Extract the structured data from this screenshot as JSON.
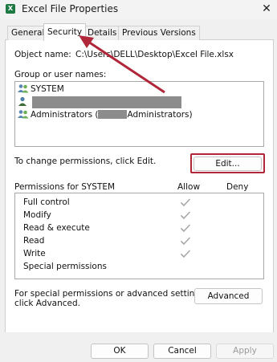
{
  "window": {
    "title": "Excel File Properties",
    "app_icon_letter": "X",
    "close_glyph": "✕"
  },
  "tabs": [
    {
      "label": "General"
    },
    {
      "label": "Security"
    },
    {
      "label": "Details"
    },
    {
      "label": "Previous Versions"
    }
  ],
  "security": {
    "object_name_label": "Object name:",
    "object_name_value": "C:\\Users\\DELL\\Desktop\\Excel File.xlsx",
    "group_label": "Group or user names:",
    "users": [
      {
        "name": "SYSTEM",
        "icon": "user-group-icon"
      },
      {
        "name": "",
        "icon": "user-icon"
      },
      {
        "name": "Administrators (",
        "suffix": "Administrators)",
        "icon": "user-group-icon"
      }
    ],
    "change_text": "To change permissions, click Edit.",
    "edit_button": "Edit...",
    "permissions_for": "Permissions for SYSTEM",
    "allow_header": "Allow",
    "deny_header": "Deny",
    "permissions": [
      {
        "name": "Full control",
        "allow": true,
        "deny": false
      },
      {
        "name": "Modify",
        "allow": true,
        "deny": false
      },
      {
        "name": "Read & execute",
        "allow": true,
        "deny": false
      },
      {
        "name": "Read",
        "allow": true,
        "deny": false
      },
      {
        "name": "Write",
        "allow": true,
        "deny": false
      },
      {
        "name": "Special permissions",
        "allow": false,
        "deny": false
      }
    ],
    "advanced_text_line1": "For special permissions or advanced settings,",
    "advanced_text_line2": "click Advanced.",
    "advanced_button": "Advanced"
  },
  "footer": {
    "ok": "OK",
    "cancel": "Cancel",
    "apply": "Apply"
  },
  "colors": {
    "annotation": "#b0273a",
    "check": "#a8a8a8"
  }
}
